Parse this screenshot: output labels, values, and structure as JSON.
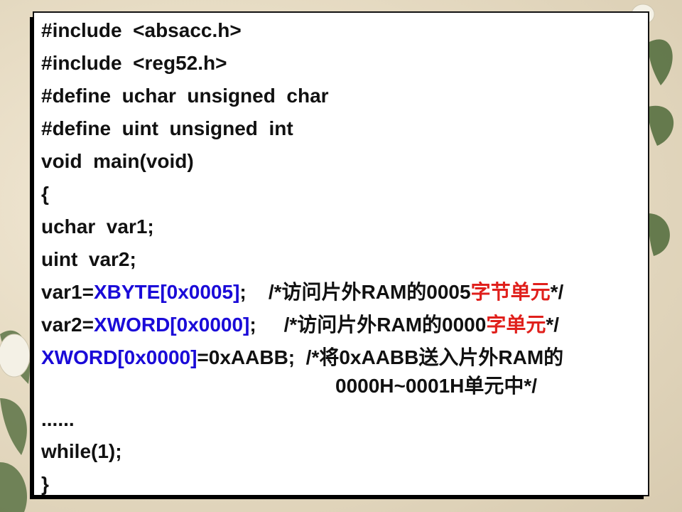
{
  "code_lines": [
    {
      "segments": [
        {
          "text": "#include  <absacc.h>",
          "color": "black"
        }
      ]
    },
    {
      "segments": [
        {
          "text": "#include  <reg52.h>",
          "color": "black"
        }
      ]
    },
    {
      "segments": [
        {
          "text": "#define  uchar  unsigned  char",
          "color": "black"
        }
      ]
    },
    {
      "segments": [
        {
          "text": "#define  uint  unsigned  int",
          "color": "black"
        }
      ]
    },
    {
      "segments": [
        {
          "text": "void  main(void)",
          "color": "black"
        }
      ]
    },
    {
      "segments": [
        {
          "text": "{",
          "color": "black"
        }
      ]
    },
    {
      "segments": [
        {
          "text": "uchar  var1;",
          "color": "black"
        }
      ]
    },
    {
      "segments": [
        {
          "text": "uint  var2;",
          "color": "black"
        }
      ]
    },
    {
      "segments": [
        {
          "text": "var1=",
          "color": "black"
        },
        {
          "text": "XBYTE[0x0005]",
          "color": "blue"
        },
        {
          "text": ";    /*访问片外RAM的0005",
          "color": "black"
        },
        {
          "text": "字节单元",
          "color": "red"
        },
        {
          "text": "*/",
          "color": "black"
        }
      ]
    },
    {
      "segments": [
        {
          "text": "var2=",
          "color": "black"
        },
        {
          "text": "XWORD[0x0000]",
          "color": "blue"
        },
        {
          "text": ";     /*访问片外RAM的0000",
          "color": "black"
        },
        {
          "text": "字单元",
          "color": "red"
        },
        {
          "text": "*/",
          "color": "black"
        }
      ]
    },
    {
      "segments": [
        {
          "text": "XWORD[0x0000]",
          "color": "blue"
        },
        {
          "text": "=0xAABB;  /*将0xAABB送入片外RAM的",
          "color": "black"
        }
      ]
    },
    {
      "segments": [
        {
          "text": "0000H~0001H单元中*/",
          "color": "black"
        }
      ],
      "indent": true
    },
    {
      "segments": [
        {
          "text": "......",
          "color": "black"
        }
      ]
    },
    {
      "segments": [
        {
          "text": "while(1);",
          "color": "black"
        }
      ]
    },
    {
      "segments": [
        {
          "text": "}",
          "color": "black"
        }
      ]
    }
  ],
  "colors": {
    "black": "#111111",
    "blue": "#1a0ad8",
    "red": "#e0201c"
  }
}
